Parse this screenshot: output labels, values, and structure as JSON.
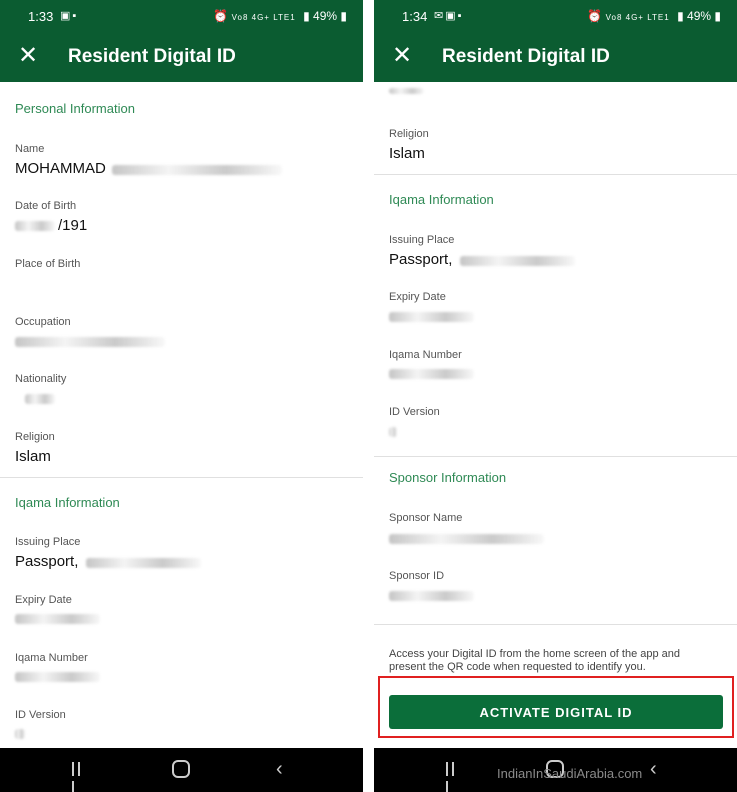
{
  "left": {
    "status": {
      "time": "1:33",
      "battery": "49%",
      "network": "Vo8 4G+ LTE1"
    },
    "appbar": {
      "title": "Resident Digital ID",
      "close_icon": "close-icon"
    },
    "sections": {
      "personal": "Personal Information",
      "iqama": "Iqama Information"
    },
    "fields": {
      "name_label": "Name",
      "name_value": "MOHAMMAD",
      "dob_label": "Date of Birth",
      "dob_value": "/191",
      "pob_label": "Place of Birth",
      "occupation_label": "Occupation",
      "nationality_label": "Nationality",
      "religion_label": "Religion",
      "religion_value": "Islam",
      "issuing_label": "Issuing Place",
      "issuing_value": "Passport,",
      "expiry_label": "Expiry Date",
      "iqama_no_label": "Iqama Number",
      "id_version_label": "ID Version"
    }
  },
  "right": {
    "status": {
      "time": "1:34",
      "battery": "49%",
      "network": "Vo8 4G+ LTE1"
    },
    "appbar": {
      "title": "Resident Digital ID",
      "close_icon": "close-icon"
    },
    "sections": {
      "iqama": "Iqama Information",
      "sponsor": "Sponsor Information"
    },
    "fields": {
      "religion_label": "Religion",
      "religion_value": "Islam",
      "issuing_label": "Issuing Place",
      "issuing_value": "Passport,",
      "expiry_label": "Expiry Date",
      "iqama_no_label": "Iqama Number",
      "id_version_label": "ID Version",
      "sponsor_name_label": "Sponsor Name",
      "sponsor_id_label": "Sponsor ID"
    },
    "info_text": "Access your Digital ID from the home screen of the app and present the QR code when requested to identify you.",
    "activate_button": "ACTIVATE DIGITAL ID"
  },
  "watermark": "IndianInSaudiArabia.com",
  "colors": {
    "brand_green": "#0b5c31",
    "section_green": "#2f8a55",
    "highlight_red": "#e02020"
  }
}
